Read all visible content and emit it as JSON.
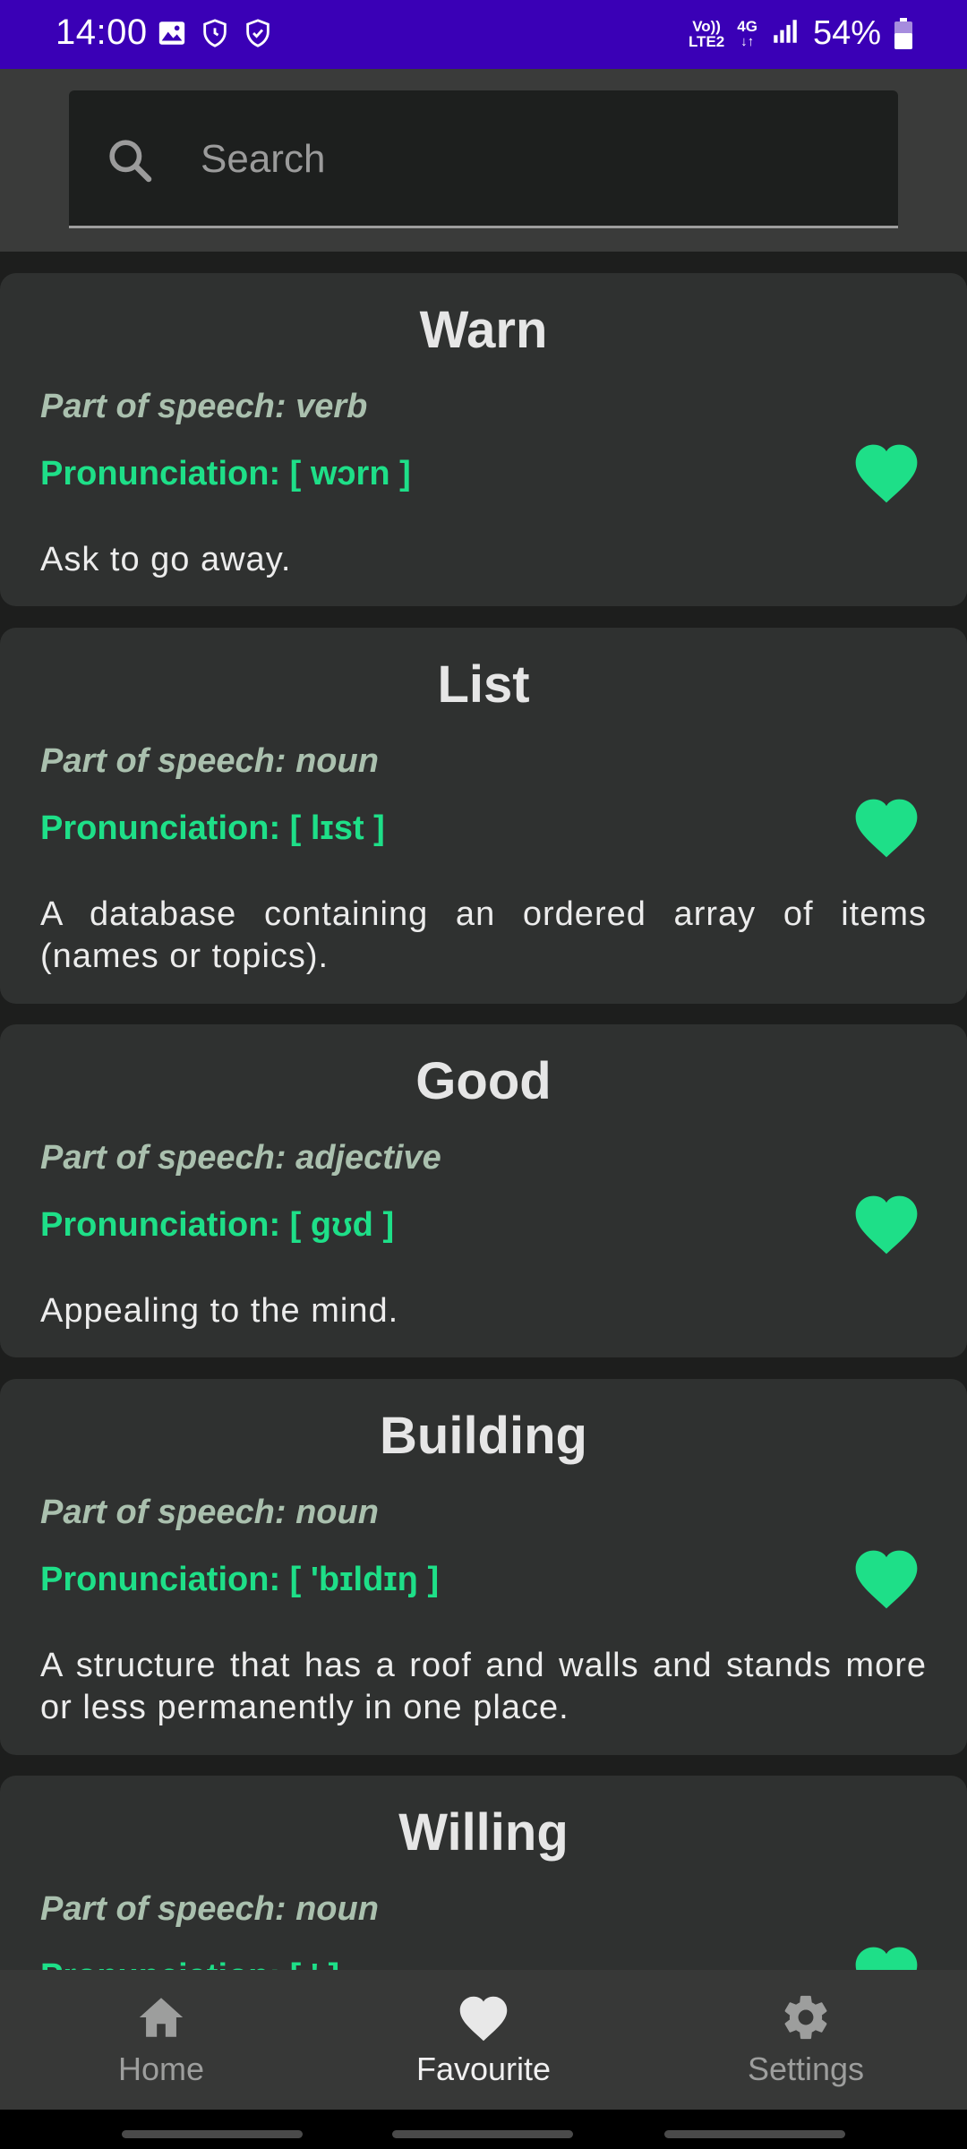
{
  "status_bar": {
    "time": "14:00",
    "network_top": "Vo))",
    "network_bottom": "LTE2",
    "network_type": "4G",
    "battery": "54%",
    "bg_color": "#3a00b6"
  },
  "search": {
    "placeholder": "Search",
    "icon": "search-icon"
  },
  "words": [
    {
      "title": "Warn",
      "part_of_speech": "Part of speech: verb",
      "pronunciation": "Pronunciation: [ wɔrn ]",
      "definition": "Ask to go away.",
      "favourite": true
    },
    {
      "title": "List",
      "part_of_speech": "Part of speech: noun",
      "pronunciation": "Pronunciation: [ lɪst ]",
      "definition": "A database containing an ordered array of items (names or topics).",
      "favourite": true
    },
    {
      "title": "Good",
      "part_of_speech": "Part of speech: adjective",
      "pronunciation": "Pronunciation: [ gʊd ]",
      "definition": "Appealing to the mind.",
      "favourite": true
    },
    {
      "title": "Building",
      "part_of_speech": "Part of speech: noun",
      "pronunciation": "Pronunciation: [ 'bɪldɪŋ ]",
      "definition": "A structure that has a roof and walls and stands more or less permanently in one place.",
      "favourite": true
    },
    {
      "title": "Willing",
      "part_of_speech": "Part of speech: noun",
      "pronunciation": "Pronunciation: [ ' ]",
      "definition": "",
      "favourite": true
    }
  ],
  "colors": {
    "accent_green": "#1edf88",
    "card_bg": "#2f3130",
    "pos_text": "#aac0ae"
  },
  "bottom_nav": {
    "items": [
      {
        "label": "Home",
        "icon": "home-icon",
        "active": false
      },
      {
        "label": "Favourite",
        "icon": "heart-icon",
        "active": true
      },
      {
        "label": "Settings",
        "icon": "gear-icon",
        "active": false
      }
    ]
  }
}
